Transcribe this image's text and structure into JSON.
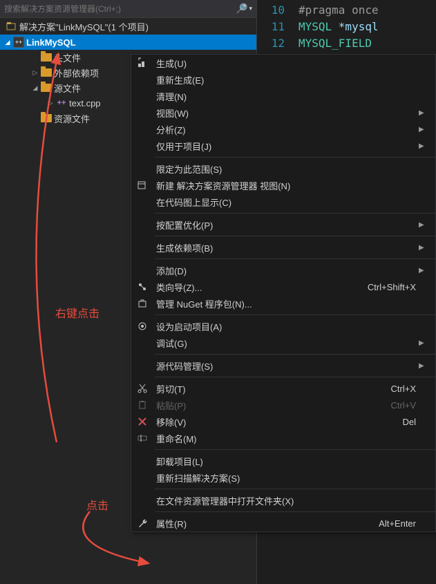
{
  "search": {
    "placeholder": "搜索解决方案资源管理器(Ctrl+;)"
  },
  "solution": {
    "label": "解决方案\"LinkMySQL\"(1 个项目)"
  },
  "tree": {
    "project": "LinkMySQL",
    "headers": "头文件",
    "external": "外部依赖项",
    "sources": "源文件",
    "textcpp": "text.cpp",
    "resources": "资源文件"
  },
  "code": {
    "l10n": "10",
    "l10": "#pragma once",
    "l11n": "11",
    "l11a": "MYSQL ",
    "l11b": "*mysql",
    "l12n": "12",
    "l12a": "MYSQL_FIELD"
  },
  "menu": {
    "build": "生成(U)",
    "rebuild": "重新生成(E)",
    "clean": "清理(N)",
    "view": "视图(W)",
    "analyze": "分析(Z)",
    "project_only": "仅用于项目(J)",
    "scope": "限定为此范围(S)",
    "new_explorer": "新建 解决方案资源管理器 视图(N)",
    "codemap": "在代码图上显示(C)",
    "optimize": "按配置优化(P)",
    "deps": "生成依赖项(B)",
    "add": "添加(D)",
    "classwiz": "类向导(Z)...",
    "classwiz_sc": "Ctrl+Shift+X",
    "nuget": "管理 NuGet 程序包(N)...",
    "startup": "设为启动项目(A)",
    "debug": "调试(G)",
    "scm": "源代码管理(S)",
    "cut": "剪切(T)",
    "cut_sc": "Ctrl+X",
    "paste": "粘贴(P)",
    "paste_sc": "Ctrl+V",
    "remove": "移除(V)",
    "remove_sc": "Del",
    "rename": "重命名(M)",
    "unload": "卸载项目(L)",
    "rescan": "重新扫描解决方案(S)",
    "open_folder": "在文件资源管理器中打开文件夹(X)",
    "props": "属性(R)",
    "props_sc": "Alt+Enter"
  },
  "annotations": {
    "rightclick": "右键点击",
    "click": "点击"
  }
}
